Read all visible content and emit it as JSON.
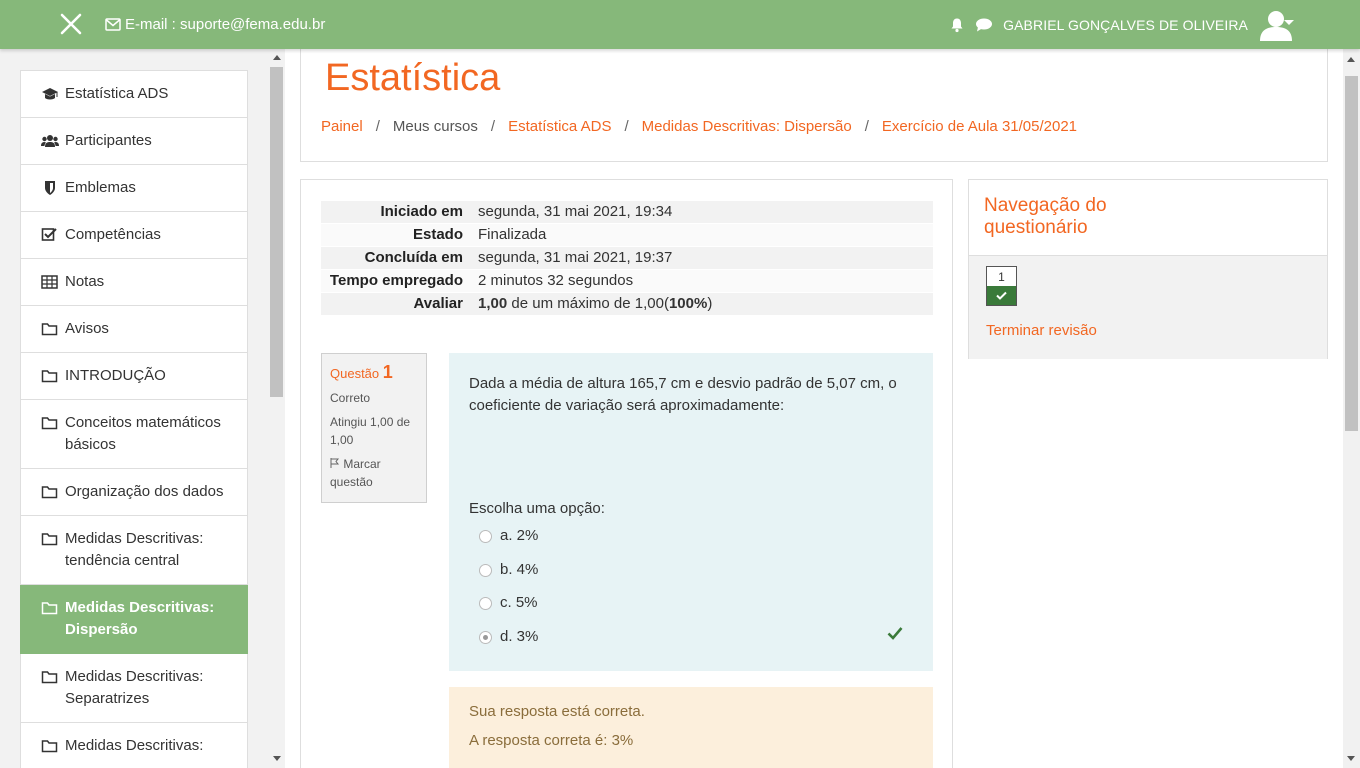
{
  "navbar": {
    "email": "E-mail : suporte@fema.edu.br",
    "user_name": "GABRIEL GONÇALVES DE OLIVEIRA",
    "icons": [
      "close-icon",
      "envelope-icon",
      "bell-icon",
      "chat-icon",
      "user-avatar-icon",
      "caret-down-icon"
    ]
  },
  "drawer": {
    "items": [
      {
        "label": "Estatística ADS",
        "icon": "graduation-cap-icon"
      },
      {
        "label": "Participantes",
        "icon": "users-icon"
      },
      {
        "label": "Emblemas",
        "icon": "shield-icon"
      },
      {
        "label": "Competências",
        "icon": "checkbox-icon"
      },
      {
        "label": "Notas",
        "icon": "table-icon"
      },
      {
        "label": "Avisos",
        "icon": "folder-icon"
      },
      {
        "label": "INTRODUÇÃO",
        "icon": "folder-icon"
      },
      {
        "label": "Conceitos matemáticos básicos",
        "icon": "folder-icon"
      },
      {
        "label": "Organização dos dados",
        "icon": "folder-icon"
      },
      {
        "label": "Medidas Descritivas: tendência central",
        "icon": "folder-icon"
      },
      {
        "label": "Medidas Descritivas: Dispersão",
        "icon": "folder-icon",
        "active": true
      },
      {
        "label": "Medidas Descritivas: Separatrizes",
        "icon": "folder-icon"
      },
      {
        "label": "Medidas Descritivas:",
        "icon": "folder-icon"
      }
    ]
  },
  "header": {
    "title": "Estatística",
    "breadcrumb": [
      {
        "label": "Painel",
        "link": true
      },
      {
        "label": "Meus cursos",
        "link": false
      },
      {
        "label": "Estatística ADS",
        "link": true
      },
      {
        "label": "Medidas Descritivas: Dispersão",
        "link": true
      },
      {
        "label": "Exercício de Aula 31/05/2021",
        "link": true
      }
    ]
  },
  "summary": {
    "rows": [
      {
        "label": "Iniciado em",
        "value": "segunda, 31 mai 2021, 19:34"
      },
      {
        "label": "Estado",
        "value": "Finalizada"
      },
      {
        "label": "Concluída em",
        "value": "segunda, 31 mai 2021, 19:37"
      },
      {
        "label": "Tempo empregado",
        "value": "2 minutos 32 segundos"
      },
      {
        "label": "Avaliar",
        "grade": "1,00",
        "mid": " de um máximo de 1,00(",
        "percent": "100%",
        "end": ")"
      }
    ]
  },
  "question": {
    "label": "Questão",
    "number": "1",
    "status": "Correto",
    "score": "Atingiu 1,00 de 1,00",
    "flag": "Marcar questão",
    "text": "Dada a média de altura 165,7 cm e desvio padrão de 5,07 cm, o coeficiente de variação será aproximadamente:",
    "prompt": "Escolha uma opção:",
    "options": [
      {
        "label": "a. 2%",
        "selected": false
      },
      {
        "label": "b. 4%",
        "selected": false
      },
      {
        "label": "c. 5%",
        "selected": false
      },
      {
        "label": "d. 3%",
        "selected": true
      }
    ],
    "feedback": "Sua resposta está correta.",
    "correct_answer": "A resposta correta é: 3%"
  },
  "quiz_nav": {
    "title": "Navegação do questionário",
    "question_buttons": [
      "1"
    ],
    "finish_review": "Terminar revisão"
  },
  "colors": {
    "brand_green": "#86b87a",
    "accent_orange": "#f26722",
    "correct_green": "#3a7a3a"
  }
}
